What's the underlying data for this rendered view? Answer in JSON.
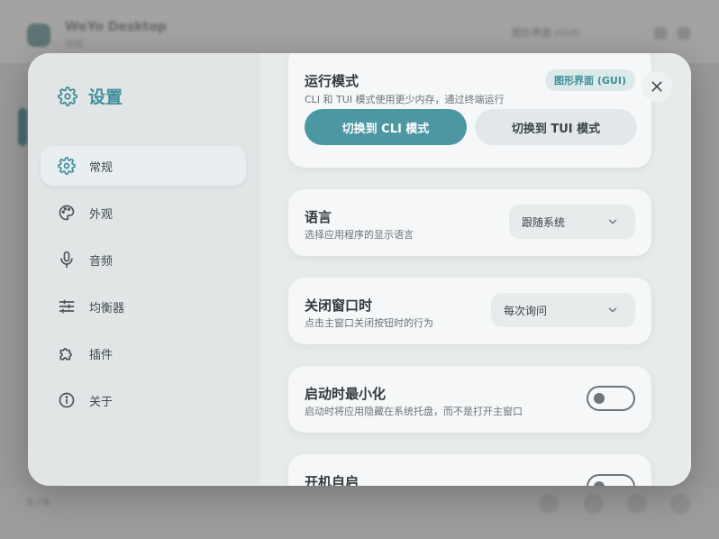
{
  "colors": {
    "accent": "#4b97a2",
    "accent_text": "#3f8f9b",
    "modal_bg": "#e9eced",
    "card_bg": "#f5f7f8"
  },
  "background_app": {
    "title": "WeYo Desktop",
    "subtitle": "就绪",
    "chip": "图形界面 (GUI)",
    "status": "0 / 0"
  },
  "settings": {
    "title": "设置",
    "title_icon": "gear-icon",
    "nav": [
      {
        "label": "常规",
        "icon": "gear-icon",
        "active": true
      },
      {
        "label": "外观",
        "icon": "palette-icon",
        "active": false
      },
      {
        "label": "音频",
        "icon": "microphone-icon",
        "active": false
      },
      {
        "label": "均衡器",
        "icon": "sliders-icon",
        "active": false
      },
      {
        "label": "插件",
        "icon": "puzzle-icon",
        "active": false
      },
      {
        "label": "关于",
        "icon": "info-icon",
        "active": false
      }
    ],
    "run_mode": {
      "title": "运行模式",
      "desc": "CLI 和 TUI 模式使用更少内存，通过终端运行",
      "current": "图形界面 (GUI)",
      "cli_button": "切换到 CLI 模式",
      "tui_button": "切换到 TUI 模式"
    },
    "language": {
      "title": "语言",
      "desc": "选择应用程序的显示语言",
      "value": "跟随系统"
    },
    "close_window": {
      "title": "关闭窗口时",
      "desc": "点击主窗口关闭按钮时的行为",
      "value": "每次询问"
    },
    "start_minimized": {
      "title": "启动时最小化",
      "desc": "启动时将应用隐藏在系统托盘，而不是打开主窗口",
      "enabled": false
    },
    "autostart": {
      "title": "开机自启",
      "enabled": false
    }
  }
}
